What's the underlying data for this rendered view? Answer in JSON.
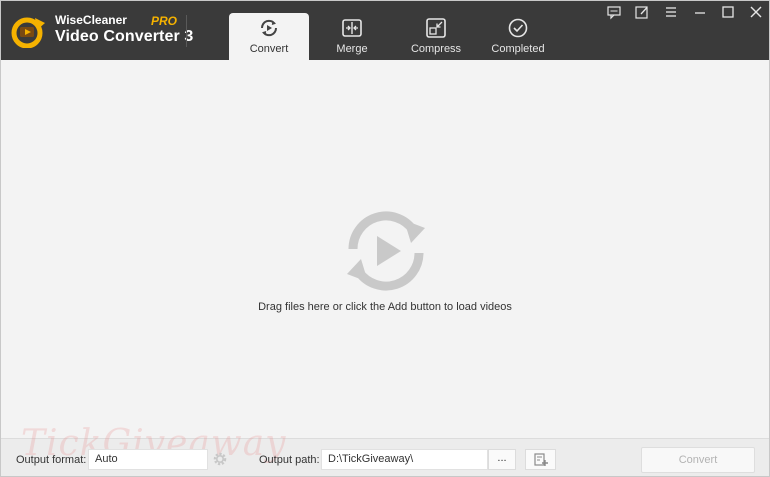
{
  "app": {
    "brand_top": "WiseCleaner",
    "brand_main": "Video Converter 3",
    "brand_badge": "PRO",
    "accent_color": "#f5b200",
    "header_color": "#3a3a3a"
  },
  "tabs": [
    {
      "label": "Convert",
      "icon": "convert-icon",
      "active": true
    },
    {
      "label": "Merge",
      "icon": "merge-icon",
      "active": false
    },
    {
      "label": "Compress",
      "icon": "compress-icon",
      "active": false
    },
    {
      "label": "Completed",
      "icon": "check-circle-icon",
      "active": false
    }
  ],
  "window_controls": [
    "feedback-icon",
    "edit-icon",
    "menu-icon",
    "minimize-icon",
    "maximize-icon",
    "close-icon"
  ],
  "main": {
    "hint": "Drag files here or click the Add button to load videos",
    "icon": "convert-play-icon"
  },
  "bottom": {
    "output_format_label": "Output format:",
    "output_format_value": "Auto",
    "output_path_label": "Output path:",
    "output_path_value": "D:\\TickGiveaway\\",
    "browse_label": "...",
    "convert_label": "Convert",
    "watermark": "TickGiveaway"
  }
}
